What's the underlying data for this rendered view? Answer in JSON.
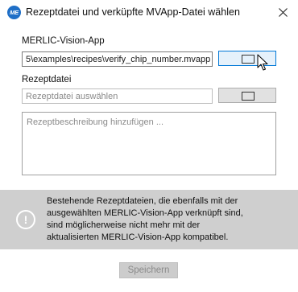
{
  "window": {
    "icon_text": "ME",
    "icon_name": "merlic-app-icon",
    "title": "Rezeptdatei und verküpfte MVApp-Datei wählen",
    "close_icon": "close-icon"
  },
  "vision_app": {
    "label": "MERLIC-Vision-App",
    "value": "5\\examples\\recipes\\verify_chip_number.mvapp",
    "browse_icon": "folder-icon"
  },
  "recipe_file": {
    "label": "Rezeptdatei",
    "placeholder": "Rezeptdatei auswählen",
    "browse_icon": "folder-icon"
  },
  "description": {
    "placeholder": "Rezeptbeschreibung hinzufügen ..."
  },
  "info": {
    "icon": "exclamation-circle-icon",
    "icon_glyph": "!",
    "lines": [
      "Bestehende Rezeptdateien, die ebenfalls mit der",
      "ausgewählten MERLIC-Vision-App verknüpft sind,",
      "sind möglicherweise nicht mehr mit der",
      "aktualisierten MERLIC-Vision-App kompatibel."
    ]
  },
  "footer": {
    "save_label": "Speichern"
  },
  "colors": {
    "accent": "#0078d7",
    "info_bg": "#cfcfcf",
    "app_icon": "#1f6fc7"
  }
}
